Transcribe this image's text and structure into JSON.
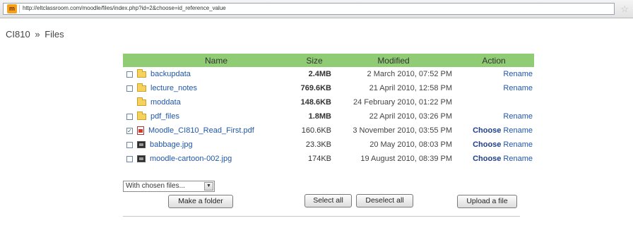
{
  "browser": {
    "url": "http://eltclassroom.com/moodle/files/index.php?id=2&choose=id_reference_value",
    "favicon_text": "m"
  },
  "breadcrumb": {
    "course": "CI810",
    "separator": "»",
    "current": "Files"
  },
  "table": {
    "headers": {
      "name": "Name",
      "size": "Size",
      "modified": "Modified",
      "action": "Action"
    },
    "header_color": "#8fcc73",
    "rows": [
      {
        "name": "backupdata",
        "icon": "folder-icon",
        "size": "2.4MB",
        "size_bold": true,
        "modified": "2 March 2010, 07:52 PM",
        "checkbox": true,
        "checked": false,
        "choose": "",
        "rename": "Rename"
      },
      {
        "name": "lecture_notes",
        "icon": "folder-icon",
        "size": "769.6KB",
        "size_bold": true,
        "modified": "21 April 2010, 12:58 PM",
        "checkbox": true,
        "checked": false,
        "choose": "",
        "rename": "Rename"
      },
      {
        "name": "moddata",
        "icon": "folder-icon",
        "size": "148.6KB",
        "size_bold": true,
        "modified": "24 February 2010, 01:22 PM",
        "checkbox": false,
        "checked": false,
        "choose": "",
        "rename": ""
      },
      {
        "name": "pdf_files",
        "icon": "folder-icon",
        "size": "1.8MB",
        "size_bold": true,
        "modified": "22 April 2010, 03:26 PM",
        "checkbox": true,
        "checked": false,
        "choose": "",
        "rename": "Rename"
      },
      {
        "name": "Moodle_CI810_Read_First.pdf",
        "icon": "pdf-icon",
        "size": "160.6KB",
        "size_bold": false,
        "modified": "3 November 2010, 03:55 PM",
        "checkbox": true,
        "checked": true,
        "choose": "Choose",
        "rename": "Rename"
      },
      {
        "name": "babbage.jpg",
        "icon": "image-icon",
        "size": "23.3KB",
        "size_bold": false,
        "modified": "20 May 2010, 08:03 PM",
        "checkbox": true,
        "checked": false,
        "choose": "Choose",
        "rename": "Rename"
      },
      {
        "name": "moodle-cartoon-002.jpg",
        "icon": "image-icon",
        "size": "174KB",
        "size_bold": false,
        "modified": "19 August 2010, 08:39 PM",
        "checkbox": true,
        "checked": false,
        "choose": "Choose",
        "rename": "Rename"
      }
    ]
  },
  "controls": {
    "with_chosen": "With chosen files...",
    "make_folder": "Make a folder",
    "select_all": "Select all",
    "deselect_all": "Deselect all",
    "upload": "Upload a file"
  }
}
